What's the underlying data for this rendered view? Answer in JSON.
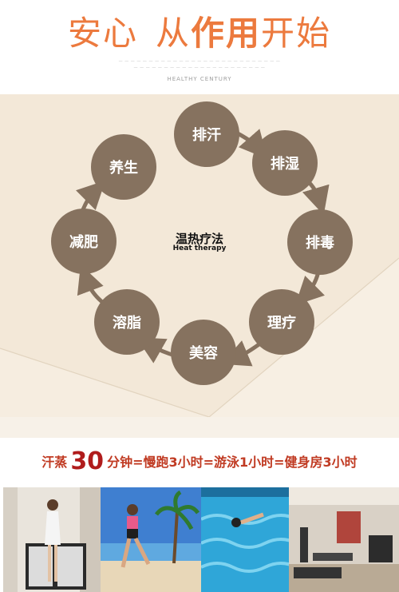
{
  "header": {
    "title_part1": "安心",
    "title_part2_plain": "从",
    "title_part2_bold": "作用",
    "title_part3": "开始",
    "subtitle_line1": "— — — — — — — — — — — — — — — — — — — — — — — — — — —",
    "subtitle_line2": "— — — — — — — — — — — — — — — — — — — — — —",
    "english": "HEALTHY CENTURY"
  },
  "cycle": {
    "center_label": "温热疗法",
    "center_sub": "Heat therapy",
    "nodes": [
      "排汗",
      "排湿",
      "排毒",
      "理疗",
      "美容",
      "溶脂",
      "减肥",
      "养生"
    ]
  },
  "equation": {
    "prefix": "汗蒸",
    "number": "30",
    "rest": "分钟=慢跑3小时=游泳1小时=健身房3小时"
  },
  "colors": {
    "title_orange": "#ec7a3e",
    "node_brown": "#86725f",
    "envelope_beige": "#f3e8d8",
    "equation_red": "#c03a22"
  },
  "photos": [
    "sauna-woman-photo",
    "beach-runner-photo",
    "swimming-pool-photo",
    "gym-photo"
  ]
}
